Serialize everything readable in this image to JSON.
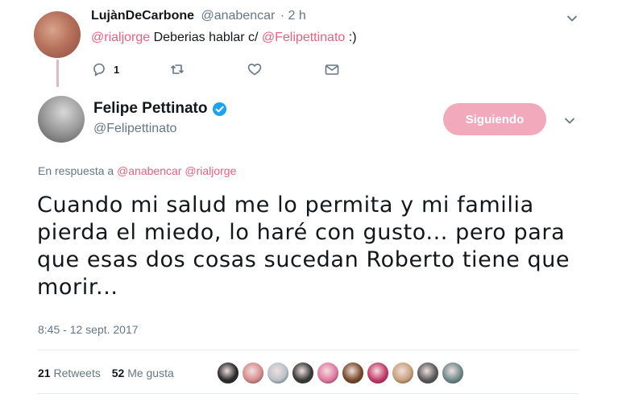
{
  "reply": {
    "name": "LujànDeCarbone",
    "handle": "@anabencar",
    "time": "· 2 h",
    "text_mention_1": "@rialjorge",
    "text_middle": " Deberias hablar c/ ",
    "text_mention_2": "@Felipettinato",
    "text_end": " :)",
    "reply_count": "1"
  },
  "tweet": {
    "name": "Felipe Pettinato",
    "handle": "@Felipettinato",
    "follow_label": "Siguiendo",
    "in_reply_prefix": "En respuesta a ",
    "in_reply_mention_1": "@anabencar",
    "in_reply_mention_2": "@rialjorge",
    "body": "Cuando mi salud me lo permita y mi familia pierda el miedo, lo haré con gusto... pero para que esas dos cosas sucedan Roberto tiene que morir...",
    "timestamp": "8:45 - 12 sept. 2017",
    "retweets_count": "21",
    "retweets_label": "Retweets",
    "likes_count": "52",
    "likes_label": "Me gusta"
  },
  "colors": {
    "accent_pink": "#e5627f",
    "button_pink": "#f2a9bc",
    "verified_blue": "#1da1f2",
    "muted": "#657786"
  },
  "icons": [
    "chevron-down-icon",
    "reply-icon",
    "retweet-icon",
    "like-icon",
    "message-icon",
    "verified-icon"
  ],
  "likers": [
    {
      "color": "#2b2b2b"
    },
    {
      "color": "#d98c8c"
    },
    {
      "color": "#b9c2c9"
    },
    {
      "color": "#3a3a3a"
    },
    {
      "color": "#e27aa0"
    },
    {
      "color": "#7a4a2a"
    },
    {
      "color": "#c53a6a"
    },
    {
      "color": "#c9a07a"
    },
    {
      "color": "#5a5a5a"
    },
    {
      "color": "#6f8a8a"
    }
  ]
}
